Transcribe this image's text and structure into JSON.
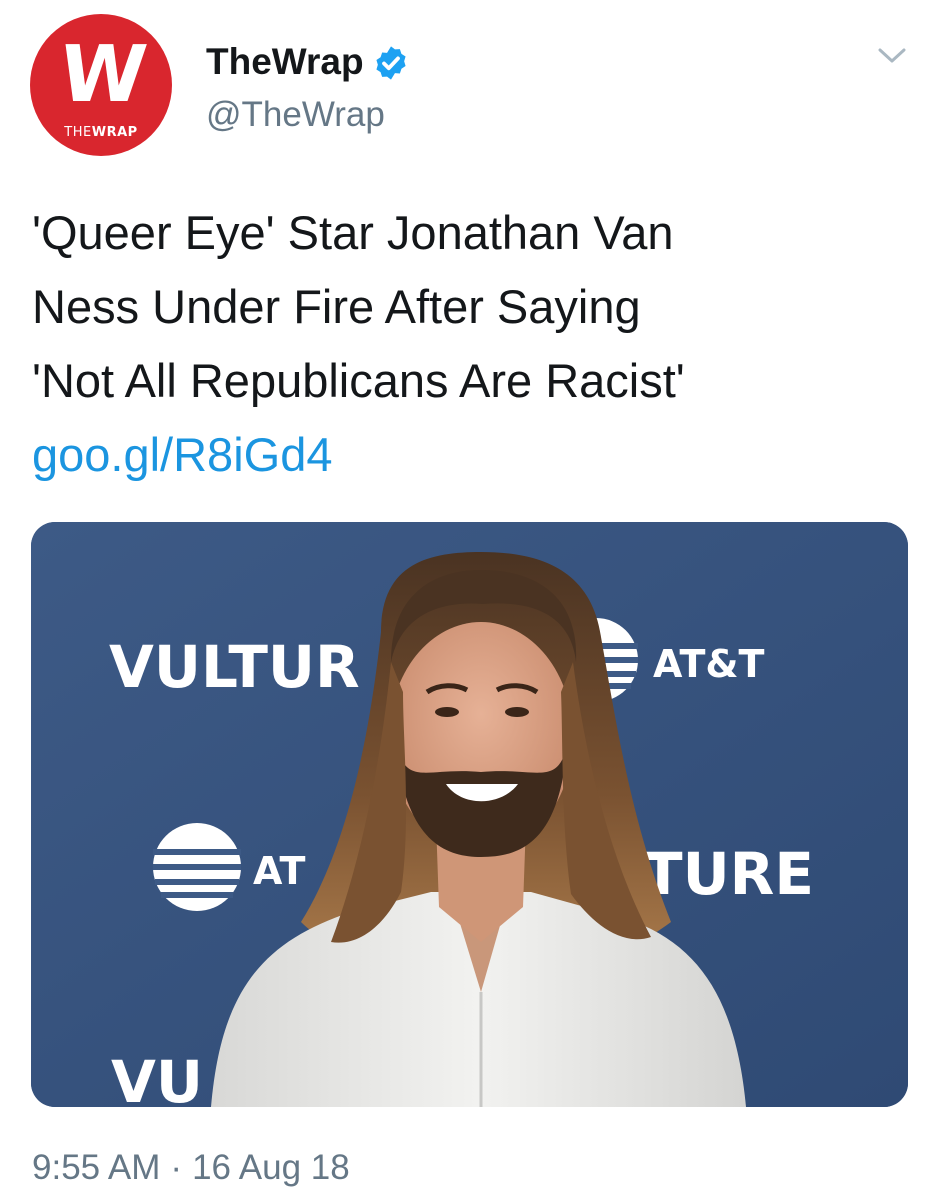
{
  "tweet": {
    "author": {
      "display_name": "TheWrap",
      "handle": "@TheWrap",
      "verified": true,
      "avatar": {
        "letter": "W",
        "wordmark_thin": "THE",
        "wordmark_bold": "WRAP",
        "background_color": "#d9262e"
      }
    },
    "text_lines": [
      "'Queer Eye' Star Jonathan Van",
      "Ness Under Fire After Saying",
      "'Not All Republicans Are Racist'"
    ],
    "link": "goo.gl/R8iGd4",
    "media": {
      "backdrop_texts": {
        "vulture_top": "VULTUR",
        "att_top": "AT&T",
        "att_mid": "AT",
        "vulture_mid": "TURE",
        "vulture_bottom": "VU"
      }
    },
    "time": "9:55 AM",
    "date": "16 Aug 18",
    "menu_icon": "chevron-down-icon"
  },
  "colors": {
    "link": "#1b95e0",
    "secondary_text": "#657786",
    "primary_text": "#14171a",
    "verified": "#1da1f2",
    "backdrop": "#37537f"
  }
}
